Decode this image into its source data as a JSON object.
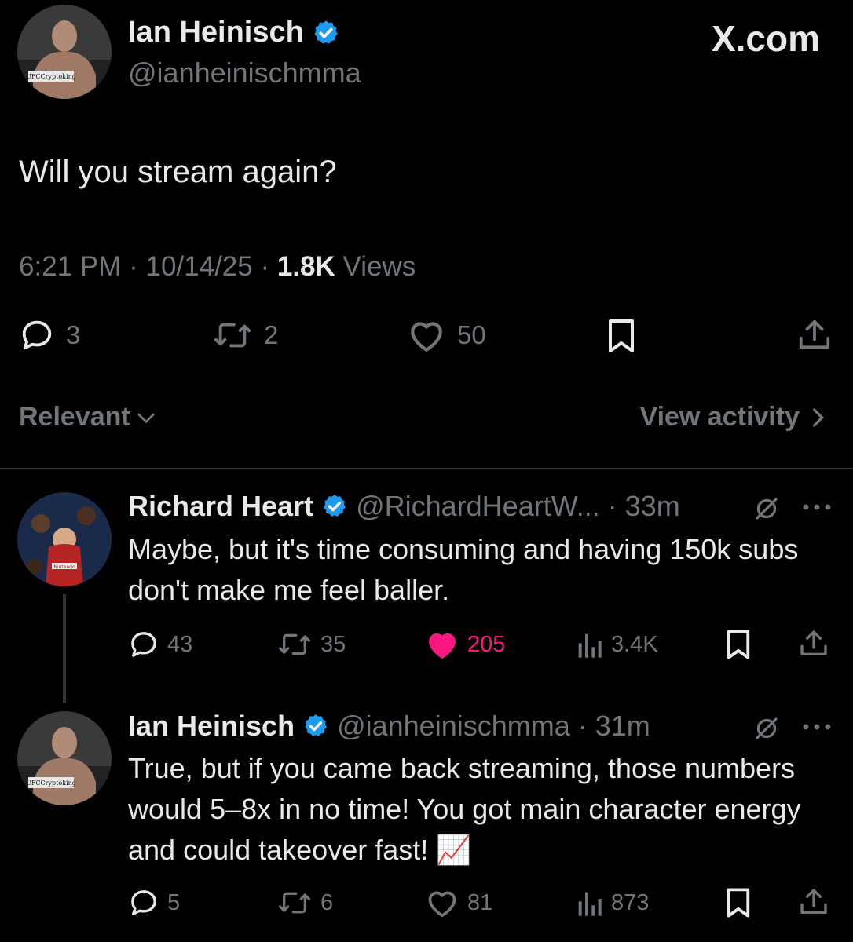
{
  "brand": "X.com",
  "main_tweet": {
    "author_name": "Ian Heinisch",
    "author_handle": "@ianheinischmma",
    "avatar_caption": "UFCCryptoking",
    "text": "Will you stream again?",
    "time": "6:21 PM",
    "date": "10/14/25",
    "views_count": "1.8K",
    "views_label": "Views",
    "replies": "3",
    "reposts": "2",
    "likes": "50"
  },
  "sort": {
    "label": "Relevant"
  },
  "view_activity": {
    "label": "View activity"
  },
  "replies": [
    {
      "author_name": "Richard Heart",
      "author_handle": "@RichardHeartW...",
      "time": "33m",
      "avatar_caption": "Nintendo",
      "text": "Maybe, but it's time consuming and having 150k subs don't make me feel baller.",
      "replies": "43",
      "reposts": "35",
      "likes": "205",
      "liked": true,
      "views": "3.4K"
    },
    {
      "author_name": "Ian Heinisch",
      "author_handle": "@ianheinischmma",
      "time": "31m",
      "avatar_caption": "UFCCryptoking",
      "text": "True, but if you came back streaming, those numbers would 5–8x in no time! You got main character energy and could takeover fast!",
      "emoji": "📈",
      "replies": "5",
      "reposts": "6",
      "likes": "81",
      "liked": false,
      "views": "873"
    }
  ],
  "colors": {
    "background": "#000000",
    "text": "#e7e9ea",
    "secondary": "#71767b",
    "verified": "#1d9bf0",
    "like": "#f91880",
    "divider": "#2f3336"
  },
  "icons": [
    "verified-badge-icon",
    "reply-icon",
    "repost-icon",
    "like-icon",
    "bookmark-icon",
    "share-icon",
    "views-icon",
    "grok-icon",
    "more-icon",
    "chevron-down-icon",
    "chevron-right-icon"
  ]
}
